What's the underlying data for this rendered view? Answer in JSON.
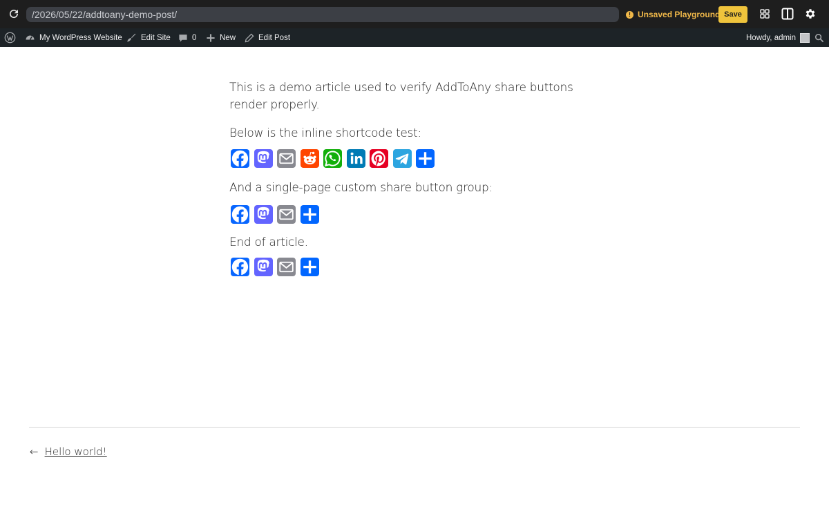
{
  "playground": {
    "url": "/2026/05/22/addtoany-demo-post/",
    "status_label": "Unsaved Playground",
    "save_label": "Save",
    "accent_color": "#f0c43c"
  },
  "admin_bar": {
    "site_name": "My WordPress Website",
    "edit_site": "Edit Site",
    "comments_count": "0",
    "new_label": "New",
    "edit_post": "Edit Post",
    "howdy": "Howdy, admin"
  },
  "article": {
    "intro": "This is a demo article used to verify AddToAny share buttons render properly.",
    "inline_test": "Below is the inline shortcode test:",
    "custom_group": "And a single-page custom share button group:",
    "end": "End of article."
  },
  "share_groups": [
    [
      "facebook",
      "mastodon",
      "email",
      "reddit",
      "whatsapp",
      "linkedin",
      "pinterest",
      "telegram",
      "share"
    ],
    [
      "facebook",
      "mastodon",
      "email",
      "share"
    ],
    [
      "facebook",
      "mastodon",
      "email",
      "share"
    ]
  ],
  "share_colors": {
    "facebook": "#0866ff",
    "mastodon": "#6364ff",
    "email": "#888990",
    "reddit": "#ff4500",
    "whatsapp": "#12af0a",
    "linkedin": "#007bb5",
    "pinterest": "#e60023",
    "telegram": "#2ca5e0",
    "share": "#0166ff"
  },
  "post_nav": {
    "arrow": "←",
    "previous_title": "Hello world!"
  }
}
